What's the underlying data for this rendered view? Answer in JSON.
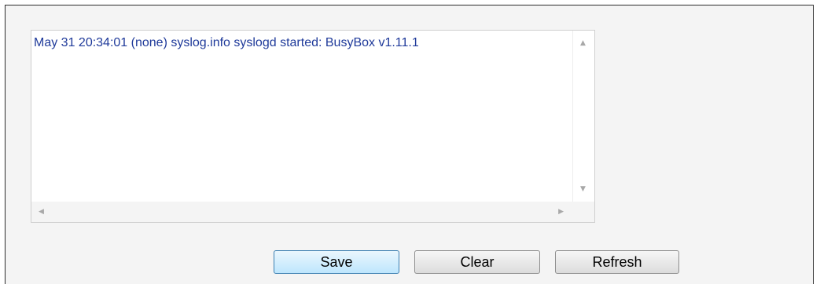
{
  "log": {
    "lines": [
      "May 31 20:34:01 (none) syslog.info syslogd started: BusyBox v1.11.1"
    ]
  },
  "scrollbars": {
    "up_icon": "▲",
    "down_icon": "▼",
    "left_icon": "◀",
    "right_icon": "▶"
  },
  "buttons": {
    "save_label": "Save",
    "clear_label": "Clear",
    "refresh_label": "Refresh"
  },
  "colors": {
    "log_text": "#1f3a9a",
    "focused_button_border": "#3c7fb1"
  }
}
